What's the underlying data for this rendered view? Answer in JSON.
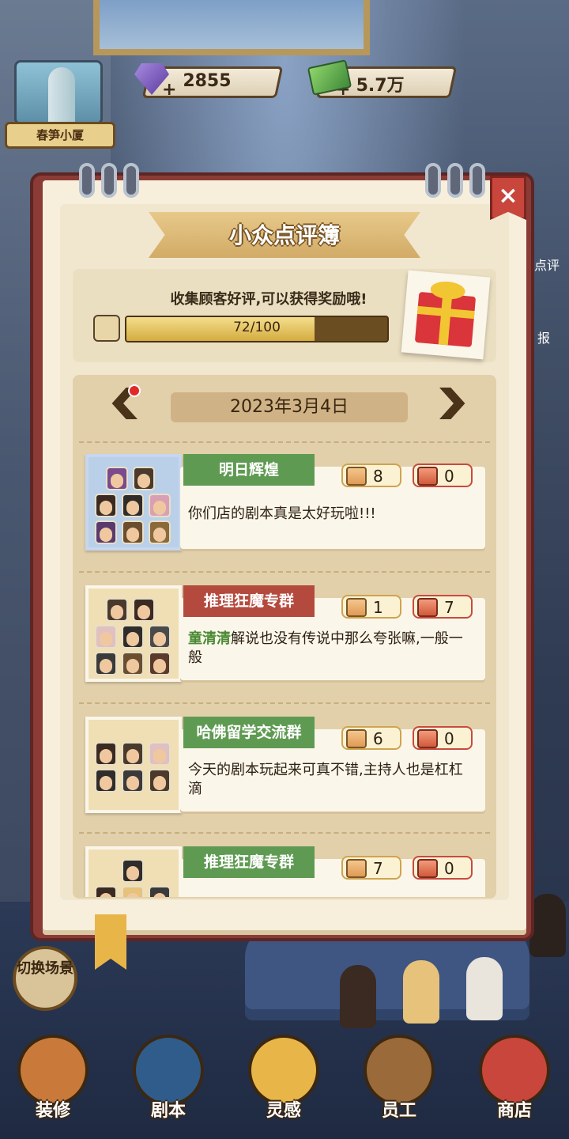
{
  "top": {
    "building_label": "春笋小厦",
    "gems": "2855",
    "cash": "5.7万",
    "plus": "+"
  },
  "modal": {
    "title": "小众点评簿",
    "close": "×",
    "reward_text": "收集顾客好评,可以获得奖励哦!",
    "progress": {
      "current": 72,
      "total": 100,
      "label": "72/100"
    },
    "date": "2023年3月4日",
    "reviews": [
      {
        "group": "明日辉煌",
        "group_color": "#5f9a52",
        "likes": "8",
        "dislikes": "0",
        "name": "",
        "comment": "你们店的剧本真是太好玩啦!!!"
      },
      {
        "group": "推理狂魔专群",
        "group_color": "#b44a3e",
        "likes": "1",
        "dislikes": "7",
        "name": "童清清",
        "comment": "解说也没有传说中那么夸张嘛,一般一般"
      },
      {
        "group": "哈佛留学交流群",
        "group_color": "#5f9a52",
        "likes": "6",
        "dislikes": "0",
        "name": "",
        "comment": "今天的剧本玩起来可真不错,主持人也是杠杠滴"
      },
      {
        "group": "推理狂魔专群",
        "group_color": "#5f9a52",
        "likes": "7",
        "dislikes": "0",
        "name": "",
        "comment": ""
      }
    ]
  },
  "side": {
    "switch_scene": "切换场景",
    "right_1": "点评",
    "right_2": "报"
  },
  "nav": [
    {
      "label": "装修",
      "icon": "shop-house-icon"
    },
    {
      "label": "剧本",
      "icon": "script-book-icon"
    },
    {
      "label": "灵感",
      "icon": "idea-orb-icon"
    },
    {
      "label": "员工",
      "icon": "staff-card-icon"
    },
    {
      "label": "商店",
      "icon": "shop-icon"
    }
  ]
}
